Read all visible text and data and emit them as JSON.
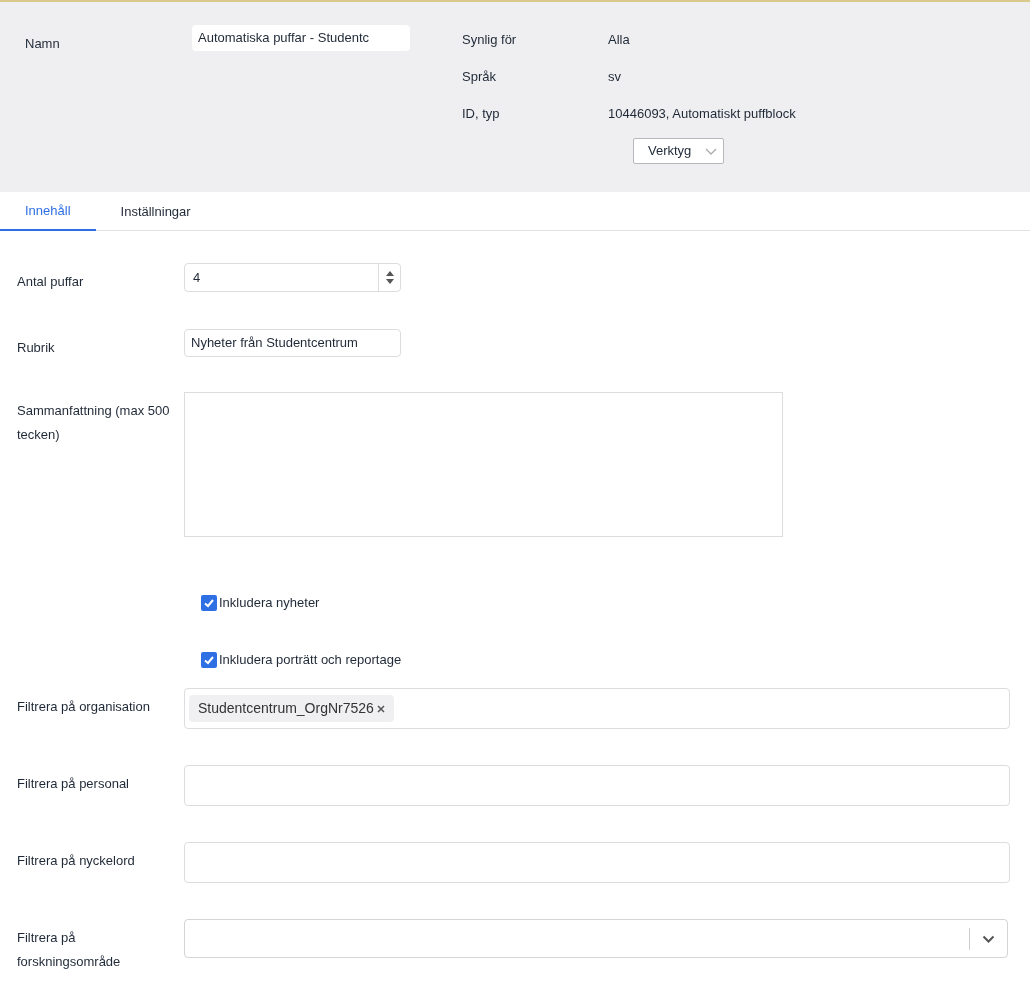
{
  "header": {
    "name_label": "Namn",
    "name_value": "Automatiska puffar - Studentc",
    "properties": [
      {
        "label": "Synlig för",
        "value": "Alla"
      },
      {
        "label": "Språk",
        "value": "sv"
      },
      {
        "label": "ID, typ",
        "value": "10446093, Automatiskt puffblock"
      }
    ],
    "tools_button": "Verktyg"
  },
  "tabs": [
    {
      "label": "Innehåll",
      "selected": true
    },
    {
      "label": "Inställningar",
      "selected": false
    }
  ],
  "fields": [
    {
      "kind": "number",
      "label": "Antal puffar",
      "value": "4"
    },
    {
      "kind": "text",
      "label": "Rubrik",
      "value": "Nyheter från Studentcentrum"
    },
    {
      "kind": "textarea",
      "label": "Sammanfattning (max 500 tecken)"
    },
    {
      "kind": "checkbox",
      "label": "Inkludera nyheter",
      "checked": true
    },
    {
      "kind": "checkbox",
      "label": "Inkludera porträtt och reportage",
      "checked": true
    },
    {
      "kind": "tags",
      "label": "Filtrera på organisation",
      "tags": [
        "Studentcentrum_OrgNr7526"
      ]
    },
    {
      "kind": "tags",
      "label": "Filtrera på personal"
    },
    {
      "kind": "tags",
      "label": "Filtrera på nyckelord"
    },
    {
      "kind": "select",
      "label": "Filtrera på forskningsområde"
    }
  ]
}
